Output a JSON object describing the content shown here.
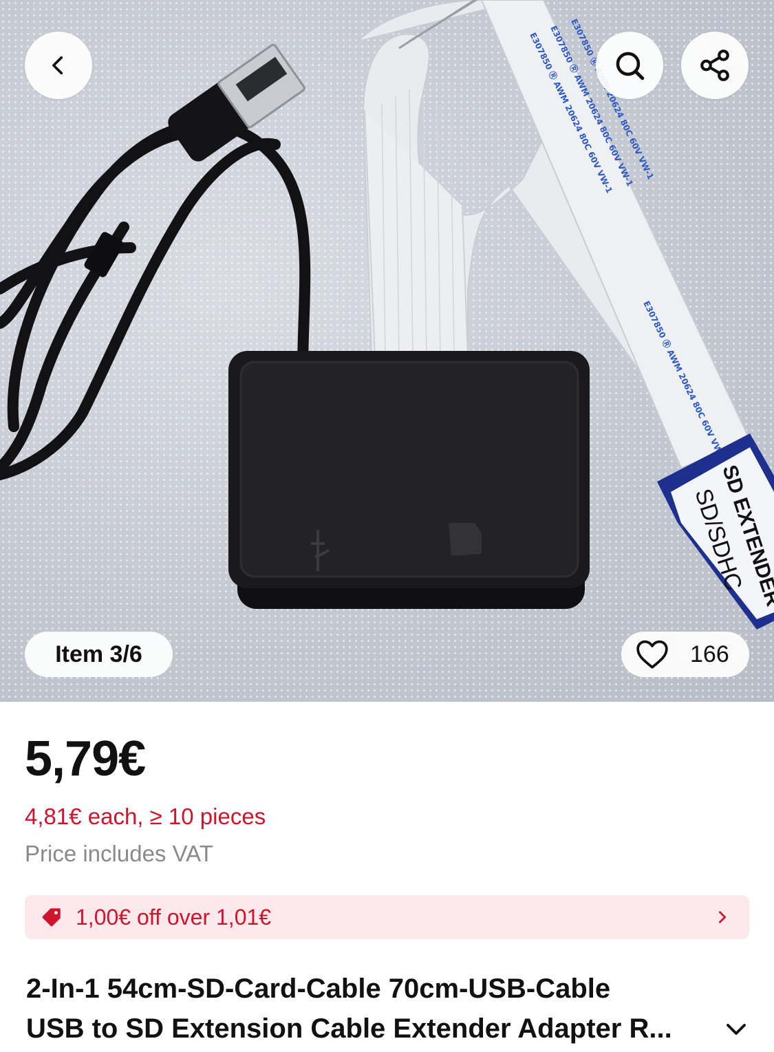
{
  "gallery": {
    "position_label": "Item 3/6",
    "like_count": "166",
    "box_print": {
      "label_line1": "SD EXTENDER",
      "label_line2": "SD/SDHC",
      "ribbon_text": "E307850 Ⓡ AWM 20624 80C 60V VW-1"
    }
  },
  "icons": {
    "back": "chevron-left-icon",
    "search": "search-icon",
    "share": "share-icon",
    "like": "heart-icon",
    "coupon": "tag-icon",
    "coupon_more": "chevron-right-icon",
    "title_expand": "chevron-down-icon"
  },
  "pricing": {
    "price": "5,79€",
    "bulk_price": "4,81€ each, ≥ 10 pieces",
    "vat_note": "Price includes VAT"
  },
  "coupon": {
    "text": "1,00€ off over 1,01€"
  },
  "product": {
    "title_line1": "2-In-1 54cm-SD-Card-Cable 70cm-USB-Cable",
    "title_line2": "USB to SD Extension Cable Extender Adapter R..."
  },
  "colors": {
    "accent_red": "#d0142c",
    "coupon_bg": "#fde9ec",
    "muted_text": "#8a8a8a",
    "sd_label_blue": "#1d2f8f"
  }
}
